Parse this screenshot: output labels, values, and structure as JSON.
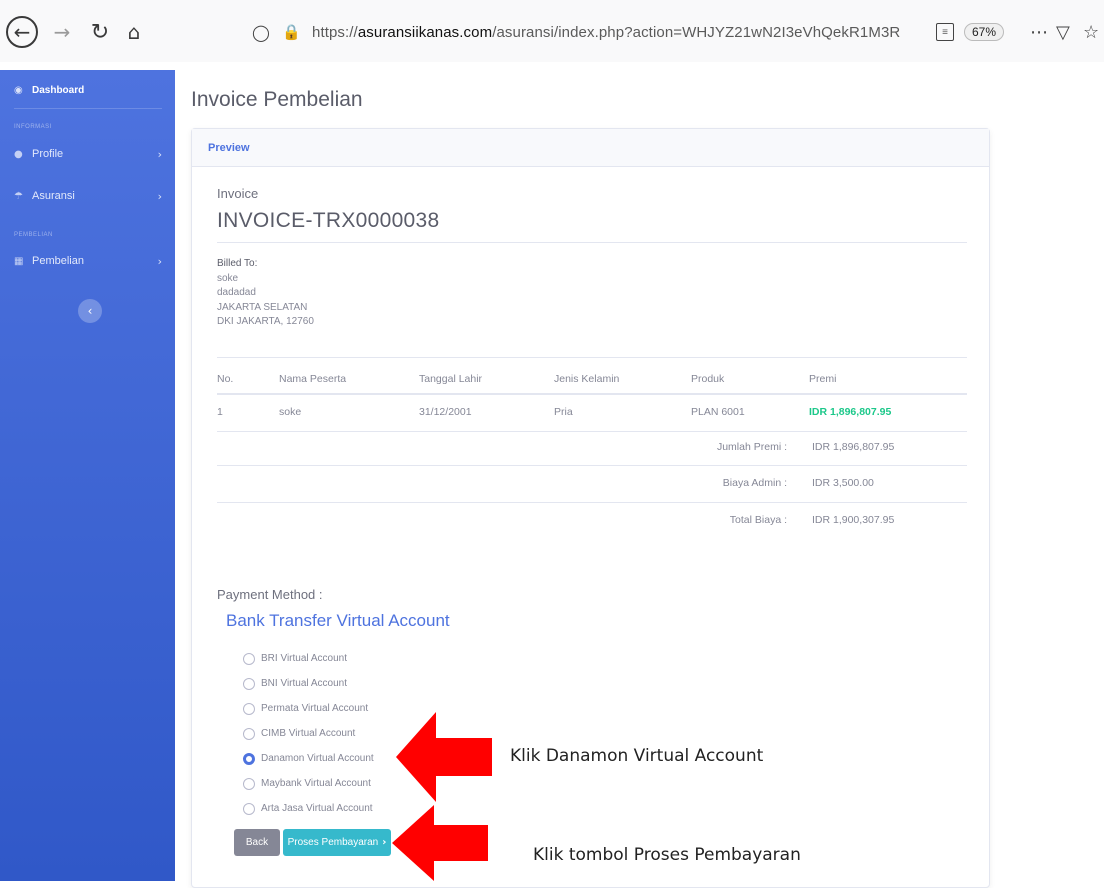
{
  "browser": {
    "url_prefix": "https://",
    "url_host": "asuransiikanas.com",
    "url_path": "/asuransi/index.php?action=WHJYZ21wN2I3eVhQekR1M3R",
    "zoom": "67%"
  },
  "sidebar": {
    "dashboard": "Dashboard",
    "heading_informasi": "INFORMASI",
    "profile": "Profile",
    "asuransi": "Asuransi",
    "heading_pembelian": "PEMBELIAN",
    "pembelian": "Pembelian"
  },
  "page": {
    "title": "Invoice Pembelian",
    "card_header": "Preview",
    "invoice_label": "Invoice",
    "invoice_number": "INVOICE-TRX0000038"
  },
  "billed": {
    "label": "Billed To:",
    "name": "soke",
    "address": "dadadad",
    "city": "JAKARTA SELATAN",
    "region": "DKI JAKARTA, 12760"
  },
  "table": {
    "headers": [
      "No.",
      "Nama Peserta",
      "Tanggal Lahir",
      "Jenis Kelamin",
      "Produk",
      "Premi"
    ],
    "rows": [
      {
        "no": "1",
        "nama": "soke",
        "tanggal": "31/12/2001",
        "jk": "Pria",
        "produk": "PLAN 6001",
        "premi": "IDR 1,896,807.95"
      }
    ]
  },
  "summary": {
    "jumlah_label": "Jumlah Premi :",
    "jumlah_value": "IDR 1,896,807.95",
    "admin_label": "Biaya Admin :",
    "admin_value": "IDR 3,500.00",
    "total_label": "Total Biaya :",
    "total_value": "IDR 1,900,307.95"
  },
  "payment": {
    "label": "Payment Method :",
    "title": "Bank Transfer Virtual Account",
    "options": [
      "BRI Virtual Account",
      "BNI Virtual Account",
      "Permata Virtual Account",
      "CIMB Virtual Account",
      "Danamon Virtual Account",
      "Maybank Virtual Account",
      "Arta Jasa Virtual Account"
    ],
    "selected": "Danamon Virtual Account"
  },
  "buttons": {
    "back": "Back",
    "proses": "Proses Pembayaran"
  },
  "annotations": {
    "note_1": "Klik Danamon Virtual Account",
    "note_2": "Klik tombol Proses Pembayaran"
  },
  "colors": {
    "sidebar": "#4e73df",
    "primary": "#4e73df",
    "success": "#1cc88a",
    "info": "#36b9cc",
    "secondary": "#858796",
    "arrow": "#ff0000"
  },
  "icons": {
    "back": "arrow-left-icon",
    "forward": "arrow-right-icon",
    "reload": "reload-icon",
    "home": "home-icon",
    "shield": "shield-icon",
    "lock": "lock-icon",
    "reader": "reader-view-icon",
    "menu": "ellipsis-icon",
    "pocket": "pocket-icon",
    "bookmark": "star-icon"
  }
}
